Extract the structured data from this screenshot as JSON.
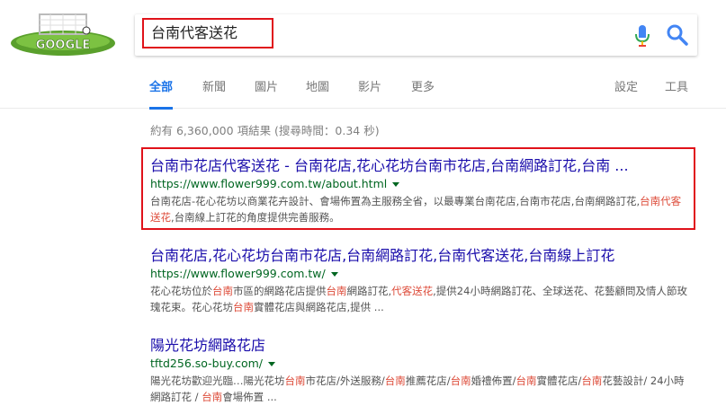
{
  "search": {
    "query": "台南代客送花"
  },
  "tabs": [
    {
      "label": "全部",
      "active": true
    },
    {
      "label": "新聞"
    },
    {
      "label": "圖片"
    },
    {
      "label": "地圖"
    },
    {
      "label": "影片"
    },
    {
      "label": "更多"
    }
  ],
  "tools": {
    "settings": "設定",
    "tools": "工具"
  },
  "stats": "約有 6,360,000 項結果 (搜尋時間：0.34 秒)",
  "results": [
    {
      "title": "台南市花店代客送花 - 台南花店,花心花坊台南市花店,台南網路訂花,台南 ...",
      "url": "https://www.flower999.com.tw/about.html",
      "snippet": [
        {
          "t": "台南花店-花心花坊以商業花卉設計、會場佈置為主服務全省，以最專業台南花店,台南市花店,台南網路訂花,"
        },
        {
          "t": "台南代客送花",
          "em": true
        },
        {
          "t": ",台南線上訂花的角度提供完善服務。"
        }
      ]
    },
    {
      "title": "台南花店,花心花坊台南市花店,台南網路訂花,台南代客送花,台南線上訂花",
      "url": "https://www.flower999.com.tw/",
      "snippet": [
        {
          "t": "花心花坊位於"
        },
        {
          "t": "台南",
          "em": true
        },
        {
          "t": "市區的網路花店提供"
        },
        {
          "t": "台南",
          "em": true
        },
        {
          "t": "網路訂花,"
        },
        {
          "t": "代客送花",
          "em": true
        },
        {
          "t": ",提供24小時網路訂花、全球送花、花藝顧問及情人節玫瑰花束。花心花坊"
        },
        {
          "t": "台南",
          "em": true
        },
        {
          "t": "實體花店與網路花店,提供 ..."
        }
      ]
    },
    {
      "title": "陽光花坊網路花店",
      "url": "tftd256.so-buy.com/",
      "snippet": [
        {
          "t": "陽光花坊歡迎光臨…陽光花坊"
        },
        {
          "t": "台南",
          "em": true
        },
        {
          "t": "市花店/外送服務/"
        },
        {
          "t": "台南",
          "em": true
        },
        {
          "t": "推薦花店/"
        },
        {
          "t": "台南",
          "em": true
        },
        {
          "t": "婚禮佈置/"
        },
        {
          "t": "台南",
          "em": true
        },
        {
          "t": "實體花店/"
        },
        {
          "t": "台南",
          "em": true
        },
        {
          "t": "花藝設計/ 24小時網路訂花 / "
        },
        {
          "t": "台南",
          "em": true
        },
        {
          "t": "會場佈置 ..."
        }
      ]
    }
  ],
  "colors": {
    "link": "#1a0dab",
    "url": "#006621",
    "emphasis": "#dd4b39",
    "active_tab": "#1a73e8",
    "annotation_box": "#e0121a"
  }
}
